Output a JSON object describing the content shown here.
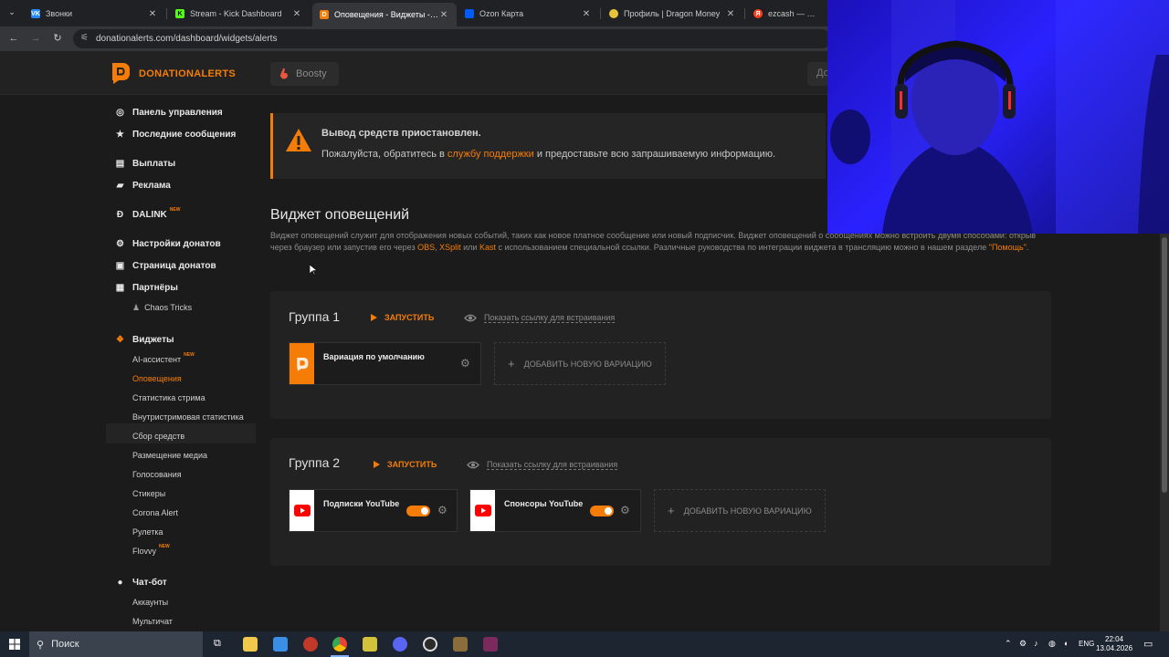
{
  "browser": {
    "tabs": [
      {
        "title": "Звонки",
        "favicon": "vk-icon",
        "color": "#2787f5",
        "glyph": "VK"
      },
      {
        "title": "Stream - Kick Dashboard",
        "favicon": "kick-icon",
        "color": "#53fc18",
        "glyph": "K"
      },
      {
        "title": "Оповещения - Виджеты - Don",
        "favicon": "donationalerts-icon",
        "color": "#f57d07",
        "glyph": "D"
      },
      {
        "title": "Ozon Карта",
        "favicon": "ozon-icon",
        "color": "#005bff",
        "glyph": "▬"
      },
      {
        "title": "Профиль | Dragon Money",
        "favicon": "dragon-money-icon",
        "color": "#e8c33a",
        "glyph": "●"
      },
      {
        "title": "ezcash — Яндекс",
        "favicon": "yandex-icon",
        "color": "#fc3f1d",
        "glyph": "Я"
      }
    ],
    "url": "donationalerts.com/dashboard/widgets/alerts"
  },
  "header": {
    "brand": "DONATIONALERTS",
    "boosty": "Boosty",
    "right_partial": "До"
  },
  "sidebar": {
    "items": [
      {
        "label": "Панель управления",
        "icon": "dashboard-icon",
        "glyph": "◎"
      },
      {
        "label": "Последние сообщения",
        "icon": "star-icon",
        "glyph": "★"
      },
      {
        "label": "Выплаты",
        "icon": "wallet-icon",
        "glyph": "▤"
      },
      {
        "label": "Реклама",
        "icon": "ads-icon",
        "glyph": "▰"
      },
      {
        "label": "DALINK",
        "icon": "dalink-icon",
        "glyph": "Ð",
        "new": "NEW"
      },
      {
        "label": "Настройки донатов",
        "icon": "gear-icon",
        "glyph": "⚙"
      },
      {
        "label": "Страница донатов",
        "icon": "page-icon",
        "glyph": "▣"
      },
      {
        "label": "Партнёры",
        "icon": "partners-icon",
        "glyph": "▦"
      },
      {
        "label": "Виджеты",
        "icon": "widgets-icon",
        "glyph": "❖"
      },
      {
        "label": "Чат-бот",
        "icon": "chatbot-icon",
        "glyph": "●"
      }
    ],
    "partner_sub": "Chaos Tricks",
    "widget_subs": [
      {
        "label": "AI-ассистент",
        "new": "NEW"
      },
      {
        "label": "Оповещения",
        "active": true
      },
      {
        "label": "Статистика стрима"
      },
      {
        "label": "Внутристримовая статистика"
      },
      {
        "label": "Сбор средств"
      },
      {
        "label": "Размещение медиа"
      },
      {
        "label": "Голосования"
      },
      {
        "label": "Стикеры"
      },
      {
        "label": "Corona Alert"
      },
      {
        "label": "Рулетка"
      },
      {
        "label": "Flovvy",
        "new": "NEW"
      }
    ],
    "chatbot_subs": [
      "Аккаунты",
      "Мультичат"
    ]
  },
  "alert": {
    "title": "Вывод средств приостановлен.",
    "text_before": "Пожалуйста, обратитесь в ",
    "link": "службу поддержки",
    "text_after": " и предоставьте всю запрашиваемую информацию."
  },
  "main": {
    "title": "Виджет оповещений",
    "desc_1": "Виджет оповещений служит для отображения новых событий, таких как новое платное сообщение или новый подписчик. Виджет оповещений о сообщениях можно встроить двумя способами: открыв через браузер или запустив его через ",
    "desc_obs": "OBS",
    "desc_comma": ", ",
    "desc_xsplit": "XSplit",
    "desc_or": " или ",
    "desc_kast": "Kast",
    "desc_2": " с использованием специальной ссылки. Различные руководства по интеграции виджета в трансляцию можно в нашем разделе ",
    "desc_help": "\"Помощь\"",
    "desc_end": "."
  },
  "groups": [
    {
      "title": "Группа 1",
      "launch": "ЗАПУСТИТЬ",
      "embed_link": "Показать ссылку для встраивания",
      "variations": [
        {
          "name": "Вариация по умолчанию",
          "type": "donationalerts",
          "toggle": false
        }
      ],
      "add_label": "ДОБАВИТЬ НОВУЮ ВАРИАЦИЮ"
    },
    {
      "title": "Группа 2",
      "launch": "ЗАПУСТИТЬ",
      "embed_link": "Показать ссылку для встраивания",
      "variations": [
        {
          "name": "Подписки YouTube",
          "type": "youtube",
          "toggle": true
        },
        {
          "name": "Спонсоры YouTube",
          "type": "youtube",
          "toggle": true
        }
      ],
      "add_label": "ДОБАВИТЬ НОВУЮ ВАРИАЦИЮ"
    }
  ],
  "taskbar": {
    "search": "Поиск",
    "lang": "ENG",
    "time": "22:04",
    "date": "13.04.2026"
  },
  "colors": {
    "accent": "#f57d07",
    "bg": "#1b1b1b",
    "card": "#222222"
  }
}
